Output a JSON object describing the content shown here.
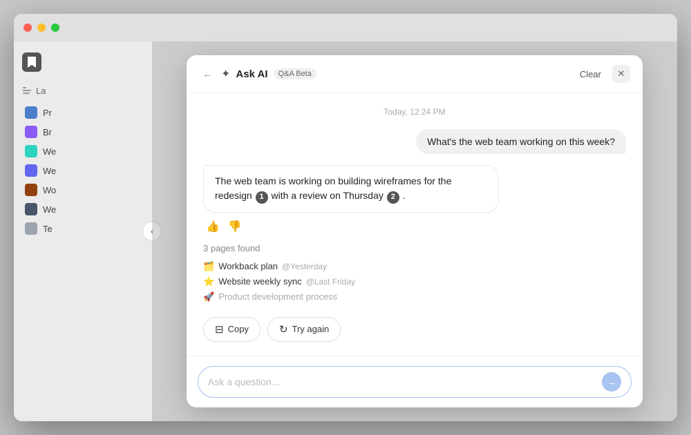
{
  "window": {
    "traffic_lights": [
      "red",
      "yellow",
      "green"
    ]
  },
  "sidebar": {
    "section_label": "La",
    "items": [
      {
        "label": "Pr",
        "icon_color": "icon-blue"
      },
      {
        "label": "Br",
        "icon_color": "icon-purple"
      },
      {
        "label": "We",
        "icon_color": "icon-teal"
      },
      {
        "label": "We",
        "icon_color": "icon-indigo"
      },
      {
        "label": "Wo",
        "icon_color": "icon-brown"
      },
      {
        "label": "We",
        "icon_color": "icon-slate"
      },
      {
        "label": "Te",
        "icon_color": "icon-gray"
      }
    ]
  },
  "modal": {
    "back_label": "←",
    "title_icon": "✦",
    "title": "Ask AI",
    "badge": "Q&A Beta",
    "clear_label": "Clear",
    "close_icon": "✕",
    "timestamp": "Today, 12:24 PM",
    "user_message": "What's the web team working on this week?",
    "ai_response_part1": "The web team is working on building wireframes for the redesign",
    "ai_response_num1": "1",
    "ai_response_part2": "with a review on Thursday",
    "ai_response_num2": "2",
    "ai_response_end": ".",
    "pages_found_label": "3 pages found",
    "pages": [
      {
        "emoji": "🗂️",
        "text": "Workback plan",
        "meta": "@Yesterday"
      },
      {
        "emoji": "⭐",
        "text": "Website weekly sync",
        "meta": "@Last Friday"
      },
      {
        "emoji": "🚀",
        "text": "Product development process",
        "meta": "",
        "dimmed": true
      }
    ],
    "copy_btn": "Copy",
    "try_again_btn": "Try again",
    "input_placeholder": "Ask a question..."
  },
  "collapse_btn": "‹",
  "icons": {
    "copy": "⊟",
    "refresh": "↻",
    "thumbs_up": "👍",
    "thumbs_down": "👎",
    "send": "→"
  }
}
